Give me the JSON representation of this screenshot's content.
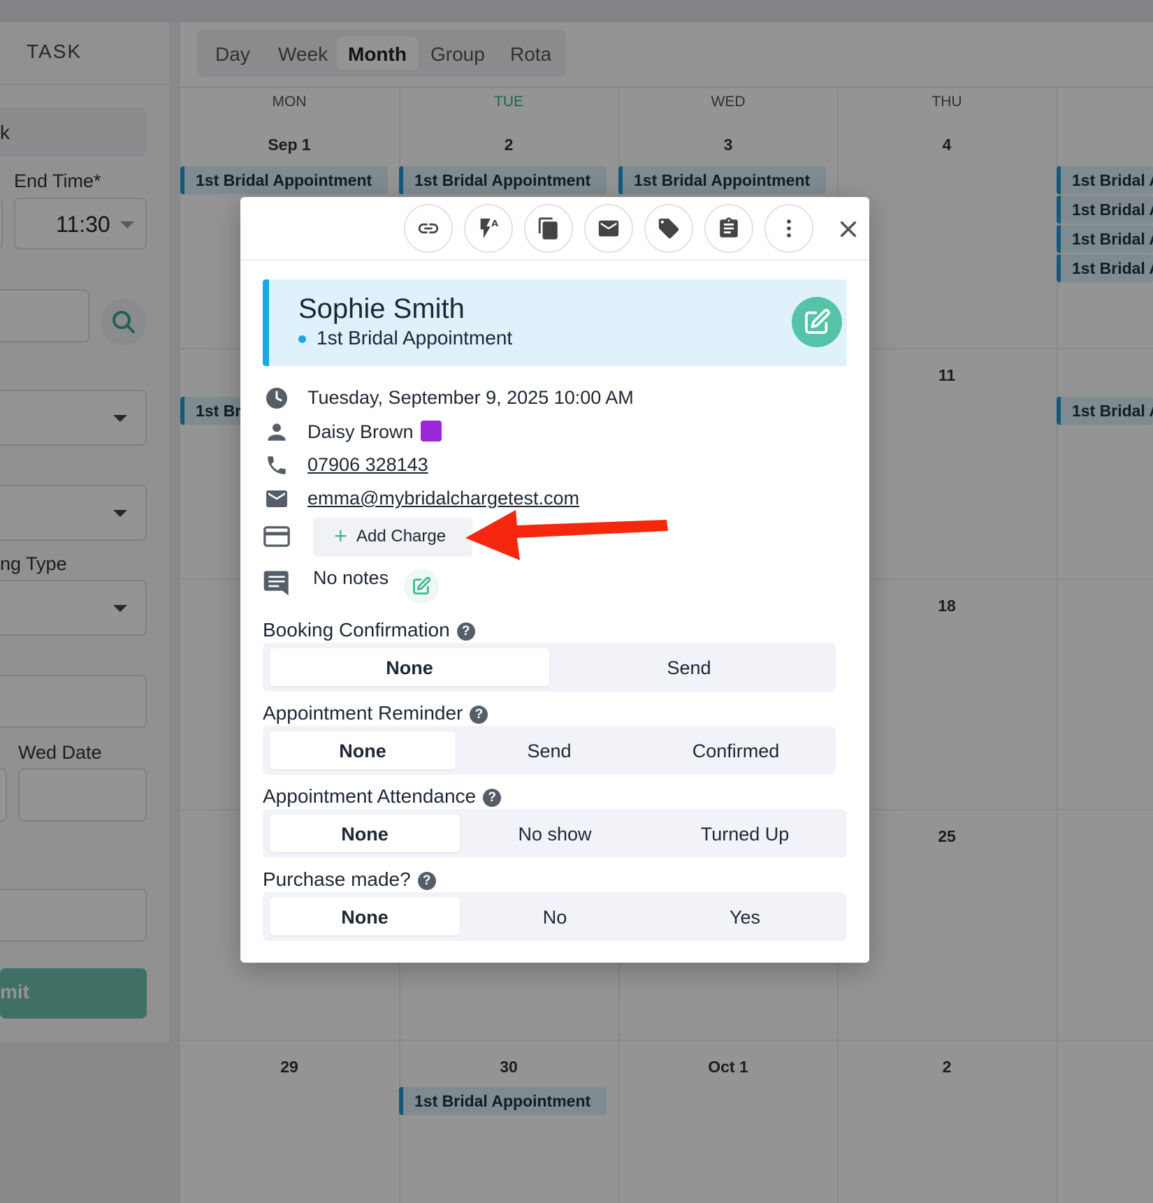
{
  "left_panel": {
    "tab_label": "TASK",
    "partial_text": "k",
    "end_time_label": "End Time*",
    "end_time_value": "11:30",
    "booking_type_label": "ng Type",
    "wed_date_label": "Wed Date",
    "submit_label": "mit"
  },
  "calendar": {
    "view_tabs": [
      "Day",
      "Week",
      "Month",
      "Group",
      "Rota"
    ],
    "active_view": "Month",
    "day_names": [
      "MON",
      "TUE",
      "WED",
      "THU"
    ],
    "today_day": "TUE",
    "week_rows": [
      [
        "Sep 1",
        "2",
        "3",
        "4"
      ],
      [
        "",
        "",
        "",
        "11"
      ],
      [
        "",
        "",
        "",
        "18"
      ],
      [
        "",
        "",
        "",
        "25"
      ],
      [
        "29",
        "30",
        "Oct 1",
        "2"
      ]
    ],
    "event_label": "1st Bridal Appointment",
    "event_label_truncated": "1st Bridal A",
    "event_label_short": "1st Bri"
  },
  "modal": {
    "client_name": "Sophie Smith",
    "appointment_type": "1st Bridal Appointment",
    "datetime": "Tuesday, September 9, 2025 10:00 AM",
    "staff_name": "Daisy Brown",
    "staff_color": "#9b27d6",
    "phone": "07906 328143",
    "email": "emma@mybridalchargetest.com",
    "add_charge_label": "Add Charge",
    "notes_text": "No notes",
    "toolbar_icons": [
      "link-icon",
      "flash-font-icon",
      "copy-icon",
      "email-icon",
      "tag-icon",
      "clipboard-icon",
      "more-vertical-icon",
      "close-icon"
    ],
    "sections": [
      {
        "label": "Booking Confirmation",
        "options": [
          "None",
          "Send"
        ],
        "selected": "None"
      },
      {
        "label": "Appointment Reminder",
        "options": [
          "None",
          "Send",
          "Confirmed"
        ],
        "selected": "None"
      },
      {
        "label": "Appointment Attendance",
        "options": [
          "None",
          "No show",
          "Turned Up"
        ],
        "selected": "None"
      },
      {
        "label": "Purchase made?",
        "options": [
          "None",
          "No",
          "Yes"
        ],
        "selected": "None"
      }
    ],
    "help_glyph": "?"
  },
  "colors": {
    "accent_teal": "#55c3a8",
    "event_blue": "#1aa7e5",
    "annotation_arrow": "#f5280f"
  }
}
